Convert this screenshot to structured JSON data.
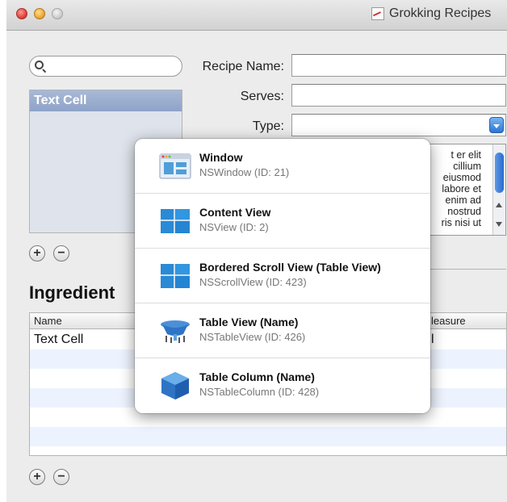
{
  "window": {
    "title": "Grokking Recipes"
  },
  "search": {
    "value": "",
    "placeholder": ""
  },
  "recipe_list": {
    "rows": [
      "Text Cell"
    ]
  },
  "form": {
    "recipe_name_label": "Recipe Name:",
    "serves_label": "Serves:",
    "type_label": "Type:",
    "recipe_name_value": "",
    "serves_value": "",
    "type_value": ""
  },
  "textview": {
    "lines": [
      "t  er  elit",
      "cillium",
      "eiusmod",
      "labore  et",
      "enim  ad",
      "nostrud",
      "ris nisi ut"
    ]
  },
  "ingredients": {
    "title": "Ingredient",
    "columns": [
      "Name",
      "leasure"
    ],
    "rows": [
      {
        "name": "Text Cell",
        "measure": "l"
      }
    ]
  },
  "popover": {
    "items": [
      {
        "name": "Window",
        "sub": "NSWindow (ID: 21)",
        "icon": "window-icon"
      },
      {
        "name": "Content View",
        "sub": "NSView (ID: 2)",
        "icon": "content-view-icon"
      },
      {
        "name": "Bordered Scroll View (Table View)",
        "sub": "NSScrollView (ID: 423)",
        "icon": "scroll-view-icon"
      },
      {
        "name": "Table View (Name)",
        "sub": "NSTableView (ID: 426)",
        "icon": "table-view-icon"
      },
      {
        "name": "Table Column (Name)",
        "sub": "NSTableColumn (ID: 428)",
        "icon": "table-column-icon"
      }
    ]
  },
  "buttons": {
    "plus": "+",
    "minus": "−"
  },
  "colors": {
    "selection": "#8ea3c8",
    "accent": "#2c74d6",
    "alt_row": "#edf3fe"
  }
}
